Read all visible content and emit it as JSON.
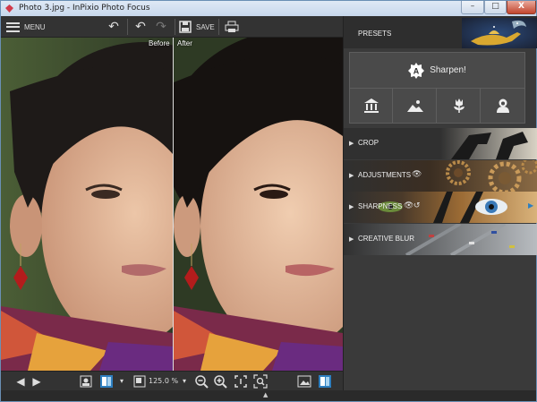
{
  "window": {
    "title": "Photo 3.jpg - InPixio Photo Focus",
    "minimize": "–",
    "maximize": "□",
    "close": "X"
  },
  "toolbar": {
    "menu_label": "MENU",
    "save_label": "SAVE",
    "undo": "↶",
    "undo_all": "↶",
    "redo": "↷",
    "print": "🖶"
  },
  "view": {
    "before_label": "Before",
    "after_label": "After"
  },
  "bottombar": {
    "zoom_value": "125.0 %",
    "prev": "◀",
    "next": "▶"
  },
  "panel": {
    "presets_label": "PRESETS",
    "sharpen_label": "Sharpen!",
    "sharpen_badge": "A",
    "preset_icons": [
      "building-icon",
      "landscape-icon",
      "flower-icon",
      "portrait-icon"
    ],
    "sections": [
      {
        "label": "CROP"
      },
      {
        "label": "ADJUSTMENTS"
      },
      {
        "label": "SHARPNESS"
      },
      {
        "label": "CREATIVE BLUR"
      }
    ]
  },
  "colors": {
    "accent": "#2e7fc0",
    "panel_bg": "#3a3a3a",
    "toolbar_bg": "#333333"
  }
}
